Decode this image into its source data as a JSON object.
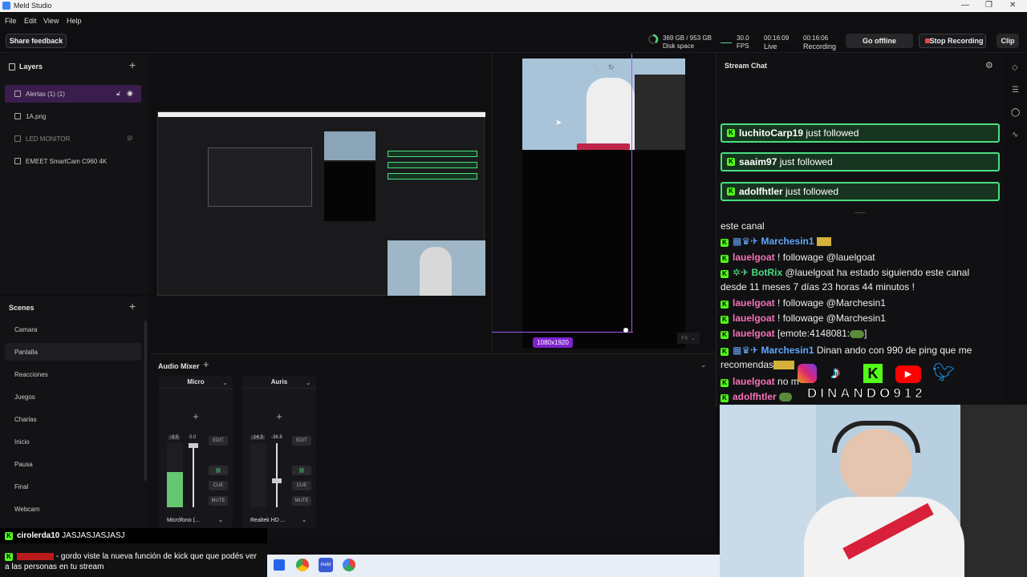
{
  "app": {
    "title": "Meld Studio"
  },
  "menu": [
    "File",
    "Edit",
    "View",
    "Help"
  ],
  "toolbar": {
    "share_feedback": "Share feedback",
    "disk": {
      "value": "369 GB / 953 GB",
      "label": "Disk space",
      "used_fraction": 0.39
    },
    "fps": {
      "value": "30.0",
      "label": "FPS"
    },
    "live": {
      "time": "00:16:09",
      "label": "Live"
    },
    "recording": {
      "time": "00:16:06",
      "label": "Recording"
    },
    "go_offline": "Go offline",
    "stop_recording": "Stop Recording",
    "clip": "Clip"
  },
  "layers": {
    "title": "Layers",
    "items": [
      {
        "label": "Alertas (1) (1)",
        "selected": true
      },
      {
        "label": "1A.png"
      },
      {
        "label": "LED MONITOR",
        "dim": true
      },
      {
        "label": "EMEET SmartCam C960 4K"
      }
    ]
  },
  "scenes": {
    "title": "Scenes",
    "items": [
      "Camara",
      "Pantalla",
      "Reacciones",
      "Juegos",
      "Charlas",
      "Inicio",
      "Pausa",
      "Final",
      "Webcam"
    ],
    "selected": "Pantalla"
  },
  "preview": {
    "resolution": "1080x1920",
    "fit": "Fit"
  },
  "audio": {
    "title": "Audio Mixer",
    "channels": [
      {
        "name": "Micro",
        "level_db": "-3.5",
        "gain": "0.0",
        "device": "Micrófono (...",
        "edit": "EDIT",
        "cue": "CUE",
        "mute": "MUTE",
        "ticks": [
          "-30",
          "-36",
          "-42",
          "-48",
          "-54"
        ],
        "level": 0.55
      },
      {
        "name": "Auris",
        "level_db": "-14.3",
        "gain": "-36.8",
        "device": "Realtek HD ...",
        "edit": "EDIT",
        "cue": "CUE",
        "mute": "MUTE",
        "level": 0.0
      }
    ]
  },
  "chat": {
    "title": "Stream Chat",
    "follows": [
      {
        "user": "luchitoCarp19",
        "text": "just followed"
      },
      {
        "user": "saaim97",
        "text": "just followed"
      },
      {
        "user": "adolfhtler",
        "text": "just followed"
      }
    ],
    "messages": [
      {
        "user": "",
        "text": "este canal"
      },
      {
        "user": "Marchesin1",
        "text": ""
      },
      {
        "user": "lauelgoat",
        "text": "! followage @lauelgoat"
      },
      {
        "user": "BotRix",
        "text": "@lauelgoat ha estado siguiendo este canal"
      },
      {
        "user": "",
        "text": "desde 11 meses 7 días 23 horas 44 minutos !"
      },
      {
        "user": "lauelgoat",
        "text": "! followage @Marchesin1"
      },
      {
        "user": "lauelgoat",
        "text": "! followage @Marchesin1"
      },
      {
        "user": "lauelgoat",
        "text": "[emote:4148081:"
      },
      {
        "user": "Marchesin1",
        "text": "Dinan ando con 990 de ping que me"
      },
      {
        "user": "",
        "text": "recomendas"
      },
      {
        "user": "lauelgoat",
        "text": "no m"
      },
      {
        "user": "adolfhtler",
        "text": ""
      }
    ],
    "overlay_handle": "DINANDO912"
  },
  "stream_overlay": {
    "msg1": {
      "user": "cirolerda10",
      "text": "JASJASJASJASJ"
    },
    "msg2": {
      "user": "",
      "text": "gordo viste la nueva función de kick que que podés ver a las personas en tu stream"
    }
  },
  "colors": {
    "kick": "#53fc18",
    "accent": "#9333ea",
    "record": "#ef4444"
  }
}
